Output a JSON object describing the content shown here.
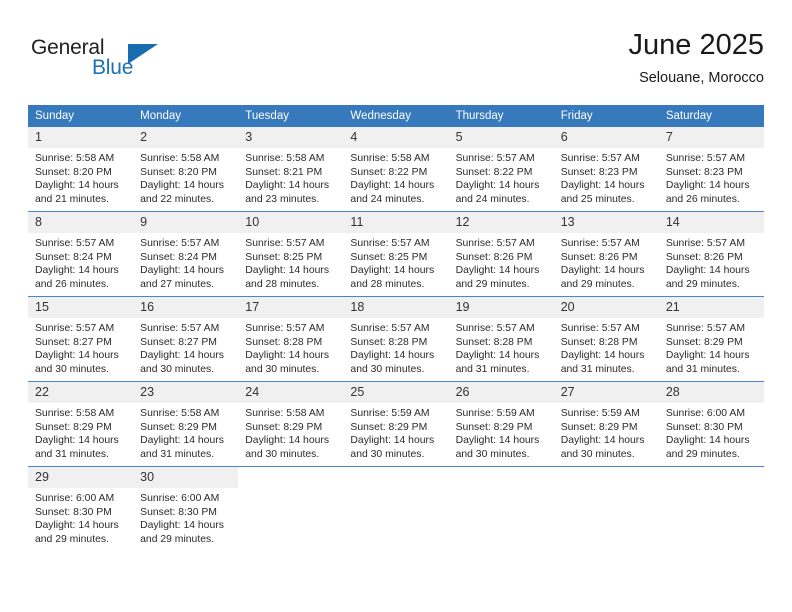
{
  "brand": {
    "name_part1": "General",
    "name_part2": "Blue",
    "triangle_color": "#1a6cb0",
    "blue_text_color": "#1d71b8"
  },
  "header": {
    "title": "June 2025",
    "subtitle": "Selouane, Morocco"
  },
  "theme": {
    "header_row_bg": "#3679bc",
    "header_row_text": "#ffffff",
    "daynum_bg": "#f0f0f0",
    "row_divider": "#4a86c5",
    "page_bg": "#ffffff"
  },
  "labels": {
    "sunrise_prefix": "Sunrise:",
    "sunset_prefix": "Sunset:",
    "daylight_prefix": "Daylight:"
  },
  "weekday_headers": [
    "Sunday",
    "Monday",
    "Tuesday",
    "Wednesday",
    "Thursday",
    "Friday",
    "Saturday"
  ],
  "weeks": [
    [
      {
        "day": "1",
        "sunrise": "Sunrise: 5:58 AM",
        "sunset": "Sunset: 8:20 PM",
        "daylight_l1": "Daylight: 14 hours",
        "daylight_l2": "and 21 minutes."
      },
      {
        "day": "2",
        "sunrise": "Sunrise: 5:58 AM",
        "sunset": "Sunset: 8:20 PM",
        "daylight_l1": "Daylight: 14 hours",
        "daylight_l2": "and 22 minutes."
      },
      {
        "day": "3",
        "sunrise": "Sunrise: 5:58 AM",
        "sunset": "Sunset: 8:21 PM",
        "daylight_l1": "Daylight: 14 hours",
        "daylight_l2": "and 23 minutes."
      },
      {
        "day": "4",
        "sunrise": "Sunrise: 5:58 AM",
        "sunset": "Sunset: 8:22 PM",
        "daylight_l1": "Daylight: 14 hours",
        "daylight_l2": "and 24 minutes."
      },
      {
        "day": "5",
        "sunrise": "Sunrise: 5:57 AM",
        "sunset": "Sunset: 8:22 PM",
        "daylight_l1": "Daylight: 14 hours",
        "daylight_l2": "and 24 minutes."
      },
      {
        "day": "6",
        "sunrise": "Sunrise: 5:57 AM",
        "sunset": "Sunset: 8:23 PM",
        "daylight_l1": "Daylight: 14 hours",
        "daylight_l2": "and 25 minutes."
      },
      {
        "day": "7",
        "sunrise": "Sunrise: 5:57 AM",
        "sunset": "Sunset: 8:23 PM",
        "daylight_l1": "Daylight: 14 hours",
        "daylight_l2": "and 26 minutes."
      }
    ],
    [
      {
        "day": "8",
        "sunrise": "Sunrise: 5:57 AM",
        "sunset": "Sunset: 8:24 PM",
        "daylight_l1": "Daylight: 14 hours",
        "daylight_l2": "and 26 minutes."
      },
      {
        "day": "9",
        "sunrise": "Sunrise: 5:57 AM",
        "sunset": "Sunset: 8:24 PM",
        "daylight_l1": "Daylight: 14 hours",
        "daylight_l2": "and 27 minutes."
      },
      {
        "day": "10",
        "sunrise": "Sunrise: 5:57 AM",
        "sunset": "Sunset: 8:25 PM",
        "daylight_l1": "Daylight: 14 hours",
        "daylight_l2": "and 28 minutes."
      },
      {
        "day": "11",
        "sunrise": "Sunrise: 5:57 AM",
        "sunset": "Sunset: 8:25 PM",
        "daylight_l1": "Daylight: 14 hours",
        "daylight_l2": "and 28 minutes."
      },
      {
        "day": "12",
        "sunrise": "Sunrise: 5:57 AM",
        "sunset": "Sunset: 8:26 PM",
        "daylight_l1": "Daylight: 14 hours",
        "daylight_l2": "and 29 minutes."
      },
      {
        "day": "13",
        "sunrise": "Sunrise: 5:57 AM",
        "sunset": "Sunset: 8:26 PM",
        "daylight_l1": "Daylight: 14 hours",
        "daylight_l2": "and 29 minutes."
      },
      {
        "day": "14",
        "sunrise": "Sunrise: 5:57 AM",
        "sunset": "Sunset: 8:26 PM",
        "daylight_l1": "Daylight: 14 hours",
        "daylight_l2": "and 29 minutes."
      }
    ],
    [
      {
        "day": "15",
        "sunrise": "Sunrise: 5:57 AM",
        "sunset": "Sunset: 8:27 PM",
        "daylight_l1": "Daylight: 14 hours",
        "daylight_l2": "and 30 minutes."
      },
      {
        "day": "16",
        "sunrise": "Sunrise: 5:57 AM",
        "sunset": "Sunset: 8:27 PM",
        "daylight_l1": "Daylight: 14 hours",
        "daylight_l2": "and 30 minutes."
      },
      {
        "day": "17",
        "sunrise": "Sunrise: 5:57 AM",
        "sunset": "Sunset: 8:28 PM",
        "daylight_l1": "Daylight: 14 hours",
        "daylight_l2": "and 30 minutes."
      },
      {
        "day": "18",
        "sunrise": "Sunrise: 5:57 AM",
        "sunset": "Sunset: 8:28 PM",
        "daylight_l1": "Daylight: 14 hours",
        "daylight_l2": "and 30 minutes."
      },
      {
        "day": "19",
        "sunrise": "Sunrise: 5:57 AM",
        "sunset": "Sunset: 8:28 PM",
        "daylight_l1": "Daylight: 14 hours",
        "daylight_l2": "and 31 minutes."
      },
      {
        "day": "20",
        "sunrise": "Sunrise: 5:57 AM",
        "sunset": "Sunset: 8:28 PM",
        "daylight_l1": "Daylight: 14 hours",
        "daylight_l2": "and 31 minutes."
      },
      {
        "day": "21",
        "sunrise": "Sunrise: 5:57 AM",
        "sunset": "Sunset: 8:29 PM",
        "daylight_l1": "Daylight: 14 hours",
        "daylight_l2": "and 31 minutes."
      }
    ],
    [
      {
        "day": "22",
        "sunrise": "Sunrise: 5:58 AM",
        "sunset": "Sunset: 8:29 PM",
        "daylight_l1": "Daylight: 14 hours",
        "daylight_l2": "and 31 minutes."
      },
      {
        "day": "23",
        "sunrise": "Sunrise: 5:58 AM",
        "sunset": "Sunset: 8:29 PM",
        "daylight_l1": "Daylight: 14 hours",
        "daylight_l2": "and 31 minutes."
      },
      {
        "day": "24",
        "sunrise": "Sunrise: 5:58 AM",
        "sunset": "Sunset: 8:29 PM",
        "daylight_l1": "Daylight: 14 hours",
        "daylight_l2": "and 30 minutes."
      },
      {
        "day": "25",
        "sunrise": "Sunrise: 5:59 AM",
        "sunset": "Sunset: 8:29 PM",
        "daylight_l1": "Daylight: 14 hours",
        "daylight_l2": "and 30 minutes."
      },
      {
        "day": "26",
        "sunrise": "Sunrise: 5:59 AM",
        "sunset": "Sunset: 8:29 PM",
        "daylight_l1": "Daylight: 14 hours",
        "daylight_l2": "and 30 minutes."
      },
      {
        "day": "27",
        "sunrise": "Sunrise: 5:59 AM",
        "sunset": "Sunset: 8:29 PM",
        "daylight_l1": "Daylight: 14 hours",
        "daylight_l2": "and 30 minutes."
      },
      {
        "day": "28",
        "sunrise": "Sunrise: 6:00 AM",
        "sunset": "Sunset: 8:30 PM",
        "daylight_l1": "Daylight: 14 hours",
        "daylight_l2": "and 29 minutes."
      }
    ],
    [
      {
        "day": "29",
        "sunrise": "Sunrise: 6:00 AM",
        "sunset": "Sunset: 8:30 PM",
        "daylight_l1": "Daylight: 14 hours",
        "daylight_l2": "and 29 minutes."
      },
      {
        "day": "30",
        "sunrise": "Sunrise: 6:00 AM",
        "sunset": "Sunset: 8:30 PM",
        "daylight_l1": "Daylight: 14 hours",
        "daylight_l2": "and 29 minutes."
      },
      {
        "day": "",
        "sunrise": "",
        "sunset": "",
        "daylight_l1": "",
        "daylight_l2": "",
        "blank": true
      },
      {
        "day": "",
        "sunrise": "",
        "sunset": "",
        "daylight_l1": "",
        "daylight_l2": "",
        "blank": true
      },
      {
        "day": "",
        "sunrise": "",
        "sunset": "",
        "daylight_l1": "",
        "daylight_l2": "",
        "blank": true
      },
      {
        "day": "",
        "sunrise": "",
        "sunset": "",
        "daylight_l1": "",
        "daylight_l2": "",
        "blank": true
      },
      {
        "day": "",
        "sunrise": "",
        "sunset": "",
        "daylight_l1": "",
        "daylight_l2": "",
        "blank": true
      }
    ]
  ]
}
